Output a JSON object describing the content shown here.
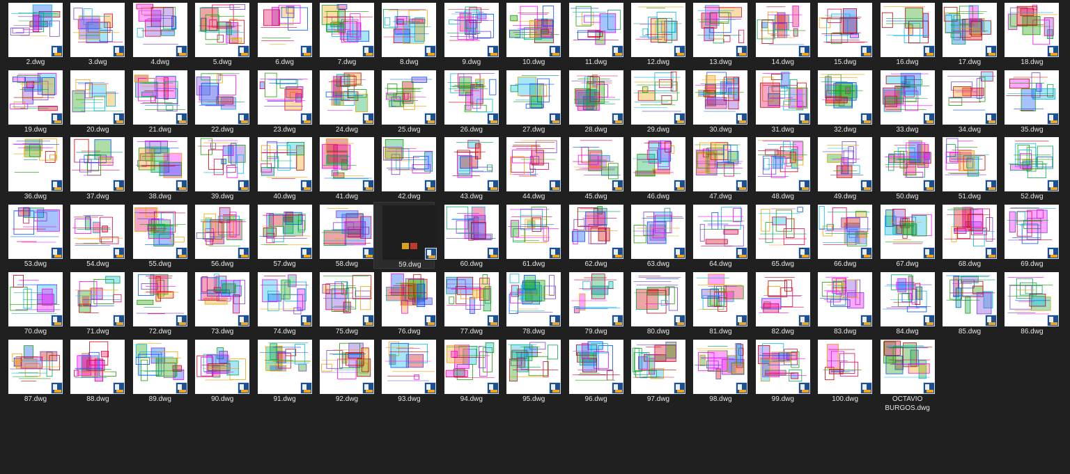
{
  "window": {
    "view": "large-icons"
  },
  "colors": {
    "background": "#202020",
    "label": "#e6e6e6",
    "thumb": "#ffffff",
    "badge": "#1c4f8f",
    "selected": "#2b2b2b"
  },
  "icons": {
    "file_badge": "dwg-file-icon",
    "thumbnail": "cad-drawing-thumbnail"
  },
  "files": [
    {
      "name": "2.dwg"
    },
    {
      "name": "3.dwg"
    },
    {
      "name": "4.dwg"
    },
    {
      "name": "5.dwg"
    },
    {
      "name": "6.dwg"
    },
    {
      "name": "7.dwg"
    },
    {
      "name": "8.dwg"
    },
    {
      "name": "9.dwg"
    },
    {
      "name": "10.dwg"
    },
    {
      "name": "11.dwg"
    },
    {
      "name": "12.dwg"
    },
    {
      "name": "13.dwg"
    },
    {
      "name": "14.dwg"
    },
    {
      "name": "15.dwg"
    },
    {
      "name": "16.dwg"
    },
    {
      "name": "17.dwg"
    },
    {
      "name": "18.dwg"
    },
    {
      "name": "19.dwg"
    },
    {
      "name": "20.dwg"
    },
    {
      "name": "21.dwg"
    },
    {
      "name": "22.dwg"
    },
    {
      "name": "23.dwg"
    },
    {
      "name": "24.dwg"
    },
    {
      "name": "25.dwg"
    },
    {
      "name": "26.dwg"
    },
    {
      "name": "27.dwg"
    },
    {
      "name": "28.dwg"
    },
    {
      "name": "29.dwg"
    },
    {
      "name": "30.dwg"
    },
    {
      "name": "31.dwg"
    },
    {
      "name": "32.dwg"
    },
    {
      "name": "33.dwg"
    },
    {
      "name": "34.dwg"
    },
    {
      "name": "35.dwg"
    },
    {
      "name": "36.dwg"
    },
    {
      "name": "37.dwg"
    },
    {
      "name": "38.dwg"
    },
    {
      "name": "39.dwg"
    },
    {
      "name": "40.dwg"
    },
    {
      "name": "41.dwg"
    },
    {
      "name": "42.dwg"
    },
    {
      "name": "43.dwg"
    },
    {
      "name": "44.dwg"
    },
    {
      "name": "45.dwg"
    },
    {
      "name": "46.dwg"
    },
    {
      "name": "47.dwg"
    },
    {
      "name": "48.dwg"
    },
    {
      "name": "49.dwg"
    },
    {
      "name": "50.dwg"
    },
    {
      "name": "51.dwg"
    },
    {
      "name": "52.dwg"
    },
    {
      "name": "53.dwg"
    },
    {
      "name": "54.dwg"
    },
    {
      "name": "55.dwg"
    },
    {
      "name": "56.dwg"
    },
    {
      "name": "57.dwg"
    },
    {
      "name": "58.dwg"
    },
    {
      "name": "59.dwg",
      "selected": true
    },
    {
      "name": "60.dwg"
    },
    {
      "name": "61.dwg"
    },
    {
      "name": "62.dwg"
    },
    {
      "name": "63.dwg"
    },
    {
      "name": "64.dwg"
    },
    {
      "name": "65.dwg"
    },
    {
      "name": "66.dwg"
    },
    {
      "name": "67.dwg"
    },
    {
      "name": "68.dwg"
    },
    {
      "name": "69.dwg"
    },
    {
      "name": "70.dwg"
    },
    {
      "name": "71.dwg"
    },
    {
      "name": "72.dwg"
    },
    {
      "name": "73.dwg"
    },
    {
      "name": "74.dwg"
    },
    {
      "name": "75.dwg"
    },
    {
      "name": "76.dwg"
    },
    {
      "name": "77.dwg"
    },
    {
      "name": "78.dwg"
    },
    {
      "name": "79.dwg"
    },
    {
      "name": "80.dwg"
    },
    {
      "name": "81.dwg"
    },
    {
      "name": "82.dwg"
    },
    {
      "name": "83.dwg"
    },
    {
      "name": "84.dwg"
    },
    {
      "name": "85.dwg"
    },
    {
      "name": "86.dwg"
    },
    {
      "name": "87.dwg"
    },
    {
      "name": "88.dwg"
    },
    {
      "name": "89.dwg"
    },
    {
      "name": "90.dwg"
    },
    {
      "name": "91.dwg"
    },
    {
      "name": "92.dwg"
    },
    {
      "name": "93.dwg"
    },
    {
      "name": "94.dwg"
    },
    {
      "name": "95.dwg"
    },
    {
      "name": "96.dwg"
    },
    {
      "name": "97.dwg"
    },
    {
      "name": "98.dwg"
    },
    {
      "name": "99.dwg"
    },
    {
      "name": "100.dwg"
    },
    {
      "name": "OCTAVIO BURGOS.dwg"
    }
  ]
}
